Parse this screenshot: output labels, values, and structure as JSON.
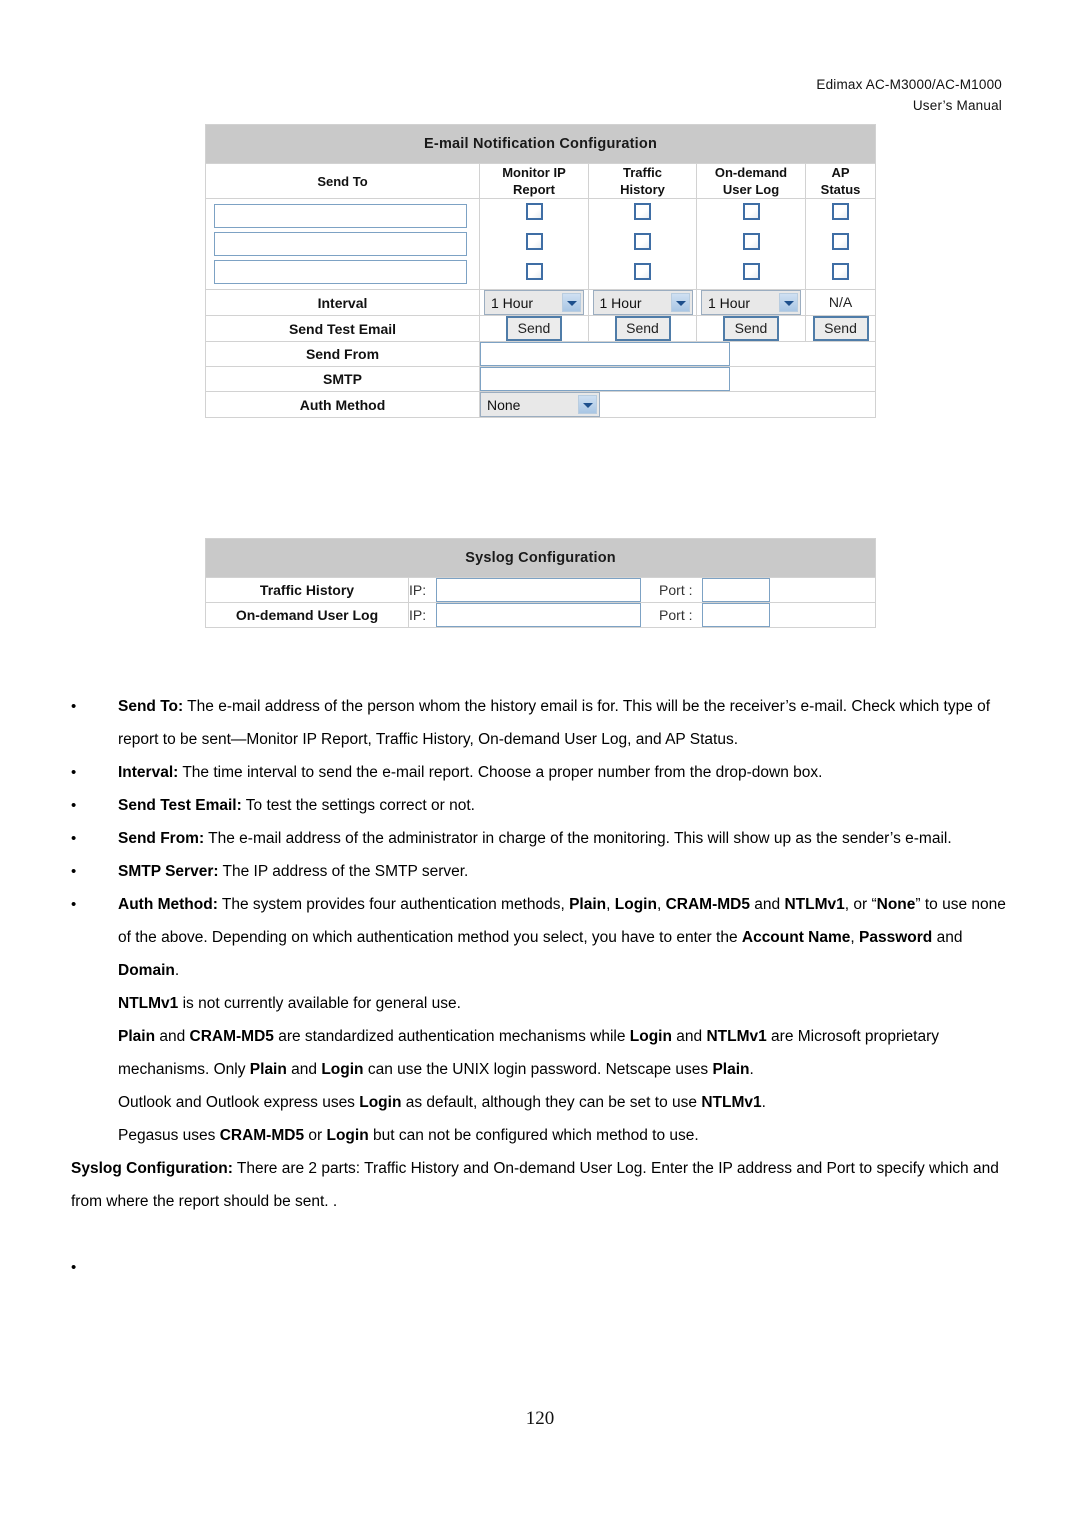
{
  "header": {
    "line1": "Edimax  AC-M3000/AC-M1000",
    "line2": "User’s  Manual"
  },
  "email_panel": {
    "title": "E-mail Notification Configuration",
    "columns": {
      "send_to": "Send To",
      "monitor_ip_report": "Monitor IP\nReport",
      "monitor_ip_report_l1": "Monitor IP",
      "monitor_ip_report_l2": "Report",
      "traffic_history_l1": "Traffic",
      "traffic_history_l2": "History",
      "on_demand_user_log_l1": "On-demand",
      "on_demand_user_log_l2": "User Log",
      "ap_status_l1": "AP",
      "ap_status_l2": "Status"
    },
    "send_to_values": [
      "",
      "",
      ""
    ],
    "checkbox_rows": [
      {
        "monitor_ip_report": false,
        "traffic_history": false,
        "on_demand_user_log": false,
        "ap_status": false
      },
      {
        "monitor_ip_report": false,
        "traffic_history": false,
        "on_demand_user_log": false,
        "ap_status": false
      },
      {
        "monitor_ip_report": false,
        "traffic_history": false,
        "on_demand_user_log": false,
        "ap_status": false
      }
    ],
    "interval": {
      "label": "Interval",
      "monitor_ip_report": "1 Hour",
      "traffic_history": "1 Hour",
      "on_demand_user_log": "1 Hour",
      "ap_status": "N/A"
    },
    "send_test_email": {
      "label": "Send Test Email",
      "button_label": "Send"
    },
    "send_from": {
      "label": "Send From",
      "value": ""
    },
    "smtp": {
      "label": "SMTP",
      "value": ""
    },
    "auth_method": {
      "label": "Auth Method",
      "value": "None"
    }
  },
  "syslog_panel": {
    "title": "Syslog Configuration",
    "ip_label": "IP:",
    "port_label": "Port :",
    "rows": [
      {
        "label": "Traffic History",
        "ip": "",
        "port": ""
      },
      {
        "label": "On-demand User Log",
        "ip": "",
        "port": ""
      }
    ]
  },
  "body": {
    "bullets": [
      {
        "term": "Send To:",
        "text": " The e-mail address of the person whom the history email is for. This will be the receiver’s e-mail. Check which type of report to be sent—Monitor IP Report, Traffic History, On-demand User Log, and AP Status."
      },
      {
        "term": "Interval:",
        "text": " The time interval to send the e-mail report. Choose a proper number from the drop-down box."
      },
      {
        "term": "Send Test Email:",
        "text": " To test the settings correct or not."
      },
      {
        "term": "Send From:",
        "text": " The e-mail address of the administrator in charge of the monitoring. This will show up as the sender’s e-mail."
      },
      {
        "term": "SMTP Server:",
        "text": " The IP address of the SMTP server."
      }
    ],
    "auth_bullet": {
      "term": "Auth Method:",
      "part1": " The system provides four authentication methods, ",
      "b1": "Plain",
      "sep1": ", ",
      "b2": "Login",
      "sep2": ", ",
      "b3": "CRAM-MD5",
      "sep3": " and ",
      "b4": "NTLMv1",
      "part2": ", or “",
      "b5": "None",
      "part3": "” to use none of the above. Depending on which authentication method you select, you have to enter the ",
      "b6": "Account Name",
      "sep4": ", ",
      "b7": "Password",
      "sep5": " and ",
      "b8": "Domain",
      "part4": "."
    },
    "paragraphs": [
      {
        "b1": "NTLMv1",
        "t1": " is not currently available for general use."
      },
      {
        "b1": "Plain",
        "t1": " and ",
        "b2": "CRAM-MD5",
        "t2": " are standardized authentication mechanisms while ",
        "b3": "Login",
        "t3": " and ",
        "b4": "NTLMv1",
        "t4": " are Microsoft proprietary mechanisms. Only ",
        "b5": "Plain",
        "t5": " and ",
        "b6": "Login",
        "t6": " can use the UNIX login password. Netscape uses ",
        "b7": "Plain",
        "t7": "."
      },
      {
        "t0": "Outlook and Outlook express uses ",
        "b1": "Login",
        "t1": " as default, although they can be set to use ",
        "b2": "NTLMv1",
        "t2": "."
      },
      {
        "t0": "Pegasus uses ",
        "b1": "CRAM-MD5",
        "t1": " or ",
        "b2": "Login",
        "t2": " but can not be configured which method to use."
      }
    ],
    "syslog_para": {
      "term": "Syslog Configuration:",
      "text": " There are 2 parts: Traffic History and On-demand User Log. Enter the IP address and Port to specify which and from where the report should be sent. ."
    },
    "trailing_bullet": "•"
  },
  "page_number": "120"
}
